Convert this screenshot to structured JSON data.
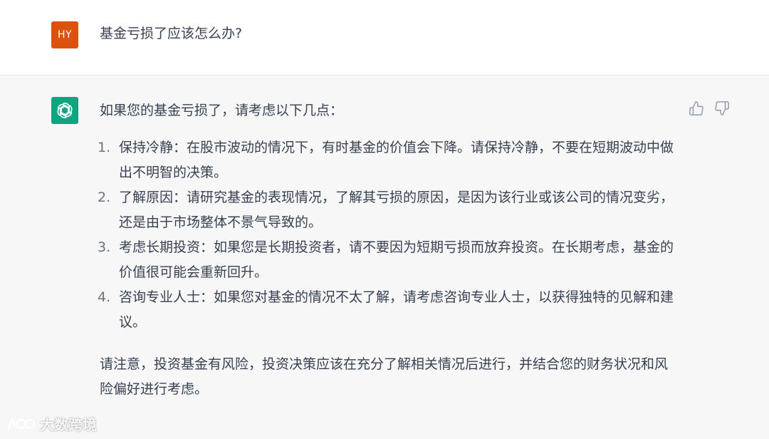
{
  "user": {
    "avatar_initials": "HY",
    "avatar_color": "#d9530f",
    "message": "基金亏损了应该怎么办?"
  },
  "assistant": {
    "avatar_color": "#10a37f",
    "avatar_icon": "openai-logo-icon",
    "intro": "如果您的基金亏损了，请考虑以下几点：",
    "points": [
      {
        "number": "1.",
        "text": "保持冷静：在股市波动的情况下，有时基金的价值会下降。请保持冷静，不要在短期波动中做出不明智的决策。"
      },
      {
        "number": "2.",
        "text": "了解原因：请研究基金的表现情况，了解其亏损的原因，是因为该行业或该公司的情况变劣，还是由于市场整体不景气导致的。"
      },
      {
        "number": "3.",
        "text": "考虑长期投资：如果您是长期投资者，请不要因为短期亏损而放弃投资。在长期考虑，基金的价值很可能会重新回升。"
      },
      {
        "number": "4.",
        "text": "咨询专业人士：如果您对基金的情况不太了解，请考虑咨询专业人士，以获得独特的见解和建议。"
      }
    ],
    "note": "请注意，投资基金有风险，投资决策应该在充分了解相关情况后进行，并结合您的财务状况和风险偏好进行考虑。",
    "feedback": {
      "up_icon": "thumbs-up-icon",
      "down_icon": "thumbs-down-icon"
    }
  },
  "watermark": {
    "text": "大数跨境"
  }
}
